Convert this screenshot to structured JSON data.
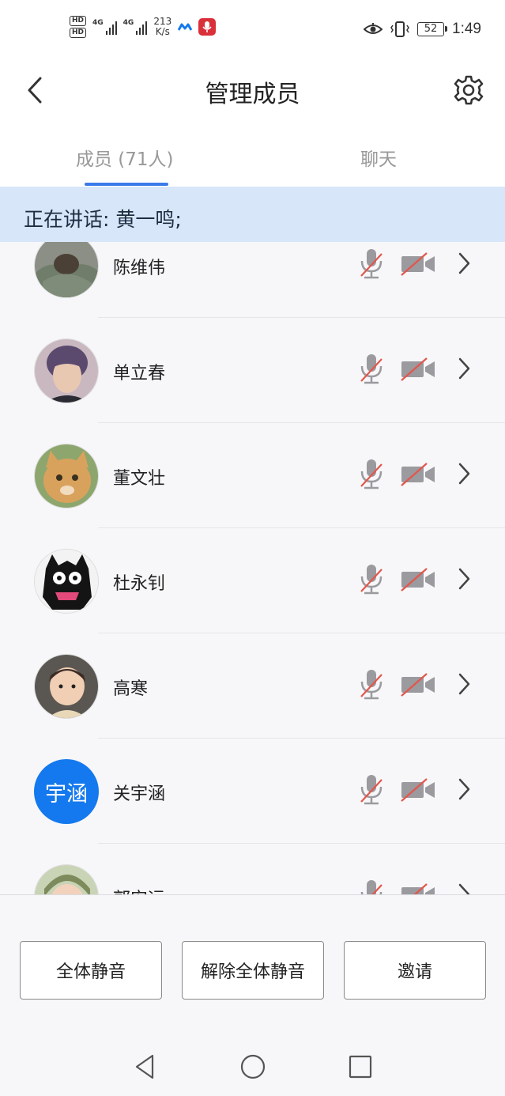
{
  "status_bar": {
    "hd1": "HD",
    "hd2": "HD",
    "sim1_net": "4G",
    "sim2_net": "4G",
    "net_speed_value": "213",
    "net_speed_unit": "K/s",
    "battery": "52",
    "time": "1:49",
    "icons": [
      "hd-icon",
      "signal-icon",
      "signal-icon",
      "mi-icon",
      "recorder-icon",
      "eye-icon",
      "vibrate-icon",
      "battery-icon"
    ]
  },
  "header": {
    "title": "管理成员",
    "back_icon": "back-chevron-icon",
    "settings_icon": "gear-icon"
  },
  "tabs": [
    {
      "label": "成员 (71人)",
      "active": true
    },
    {
      "label": "聊天",
      "active": false
    }
  ],
  "speaking_banner": "正在讲话: 黄一鸣;",
  "members": [
    {
      "name": "陈维伟",
      "avatar": "photo-cat-blanket",
      "mic_muted": true,
      "camera_off": true
    },
    {
      "name": "单立春",
      "avatar": "photo-boy",
      "mic_muted": true,
      "camera_off": true
    },
    {
      "name": "董文壮",
      "avatar": "photo-orange-cat",
      "mic_muted": true,
      "camera_off": true
    },
    {
      "name": "杜永钊",
      "avatar": "photo-monster-cartoon",
      "mic_muted": true,
      "camera_off": true
    },
    {
      "name": "高寒",
      "avatar": "photo-toddler",
      "mic_muted": true,
      "camera_off": true
    },
    {
      "name": "关宇涵",
      "avatar_text": "宇涵",
      "avatar": "text-avatar",
      "mic_muted": true,
      "camera_off": true
    },
    {
      "name": "郭安远",
      "avatar": "photo-child",
      "mic_muted": true,
      "camera_off": true
    }
  ],
  "actions": {
    "mute_all": "全体静音",
    "unmute_all": "解除全体静音",
    "invite": "邀请"
  },
  "nav": {
    "back": "nav-back-icon",
    "home": "nav-home-icon",
    "recents": "nav-recents-icon"
  },
  "colors": {
    "accent": "#3b7be9",
    "banner_bg": "#d7e6f8",
    "muted_slash": "#e2574c",
    "avatar_blue": "#1479ee"
  }
}
